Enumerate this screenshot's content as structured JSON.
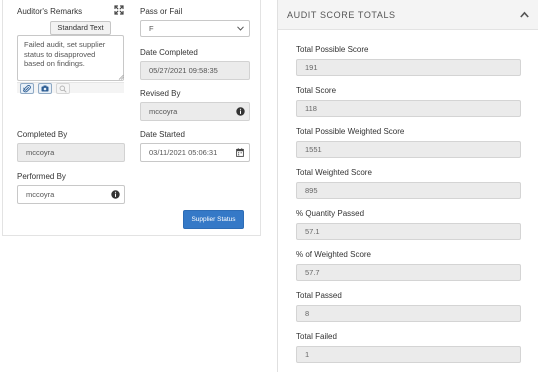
{
  "left": {
    "remarks_label": "Auditor's Remarks",
    "standard_text_button": "Standard Text",
    "remarks_text": "Failed audit, set supplier status to disapproved based on findings.",
    "pass_fail_label": "Pass or Fail",
    "pass_fail_value": "F",
    "date_completed_label": "Date Completed",
    "date_completed_value": "05/27/2021 09:58:35",
    "revised_by_label": "Revised By",
    "revised_by_value": "mccoyra",
    "completed_by_label": "Completed By",
    "completed_by_value": "mccoyra",
    "date_started_label": "Date Started",
    "date_started_value": "03/11/2021 05:06:31",
    "performed_by_label": "Performed By",
    "performed_by_value": "mccoyra",
    "supplier_status_button": "Supplier Status"
  },
  "right": {
    "title": "AUDIT SCORE TOTALS",
    "fields": [
      {
        "label": "Total Possible Score",
        "value": "191"
      },
      {
        "label": "Total Score",
        "value": "118"
      },
      {
        "label": "Total Possible Weighted Score",
        "value": "1551"
      },
      {
        "label": "Total Weighted Score",
        "value": "895"
      },
      {
        "label": "% Quantity Passed",
        "value": "57.1"
      },
      {
        "label": "% of Weighted Score",
        "value": "57.7"
      },
      {
        "label": "Total Passed",
        "value": "8"
      },
      {
        "label": "Total Failed",
        "value": "1"
      }
    ]
  },
  "colors": {
    "primary_button": "#3579c7",
    "readonly_field_bg": "#ebebeb",
    "panel_header_bg": "#f4f4f4"
  },
  "icons": [
    "expand-icon",
    "attachment-icon",
    "camera-icon",
    "zoom-icon",
    "chevron-down-icon",
    "info-icon",
    "calendar-icon",
    "collapse-chevron-icon"
  ]
}
